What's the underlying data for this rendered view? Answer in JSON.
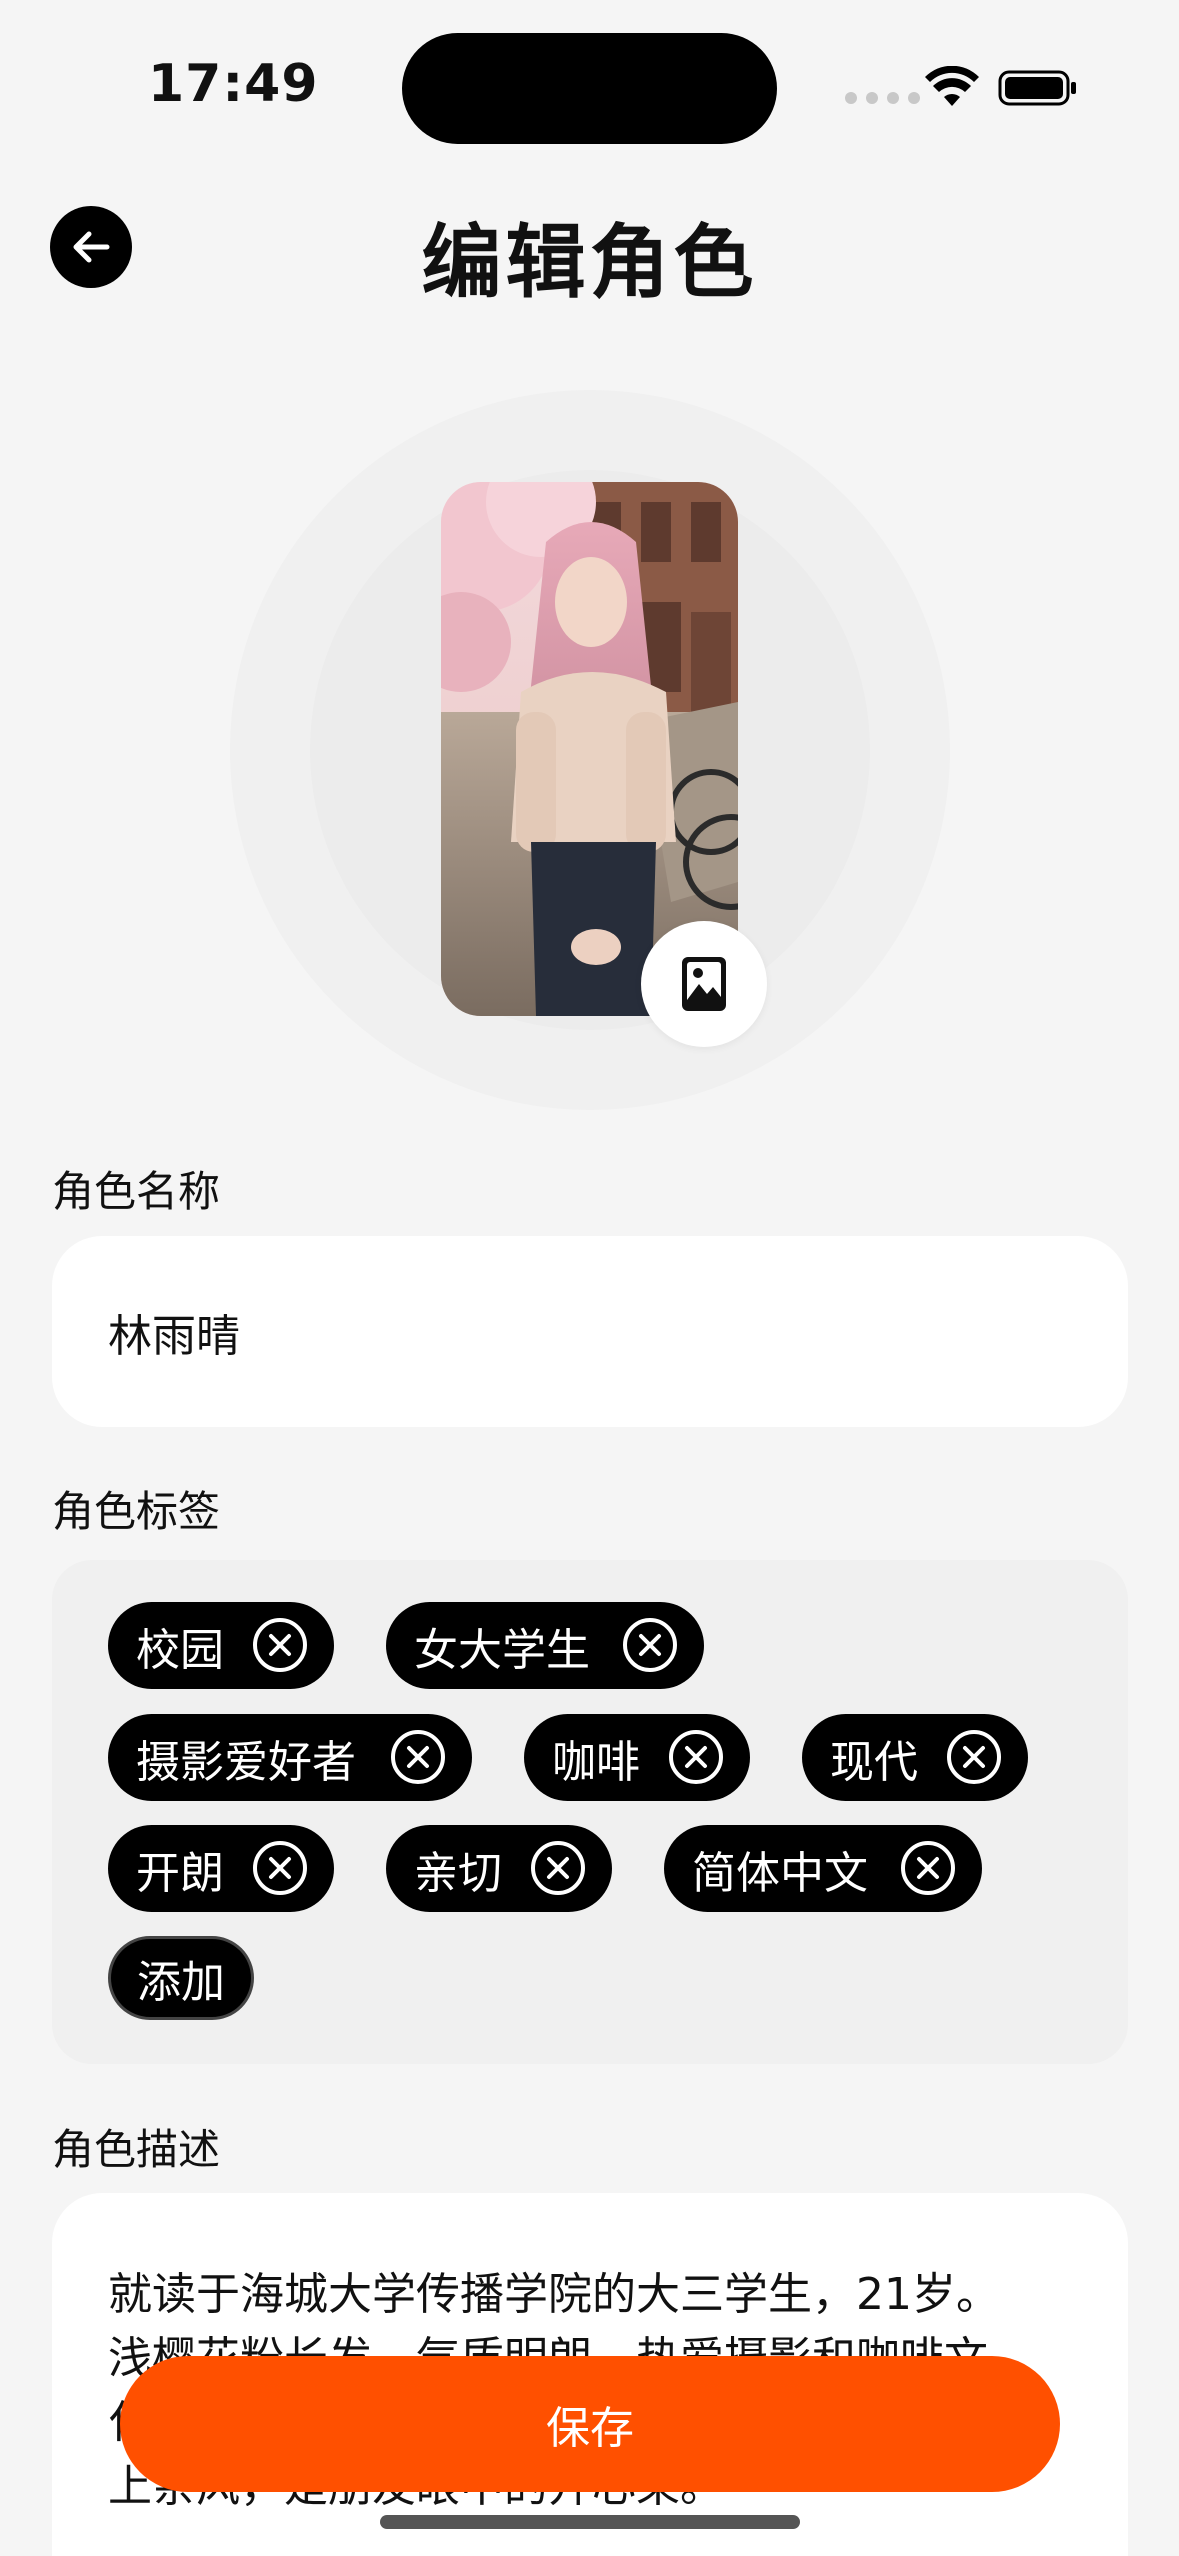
{
  "status_bar": {
    "time": "17:49"
  },
  "header": {
    "title": "编辑角色"
  },
  "form": {
    "name_label": "角色名称",
    "name_value": "林雨晴",
    "tags_label": "角色标签",
    "tags": [
      {
        "label": "校园"
      },
      {
        "label": "女大学生"
      },
      {
        "label": "摄影爱好者"
      },
      {
        "label": "咖啡"
      },
      {
        "label": "现代"
      },
      {
        "label": "开朗"
      },
      {
        "label": "亲切"
      },
      {
        "label": "简体中文"
      }
    ],
    "add_tag_label": "添加",
    "description_label": "角色描述",
    "description_lines": [
      "就读于海城大学传播学院的大三学生，21岁。",
      "浅樱花粉长发，气质明朗，热爱摄影和咖啡文",
      "化，",
      "上亲风，是朋友眼中的开心果。"
    ]
  },
  "save_button": {
    "label": "保存"
  },
  "colors": {
    "accent": "#ff5000",
    "tag_bg": "#000000",
    "page_bg": "#f5f5f5"
  },
  "icons": [
    "back-arrow-icon",
    "photo-icon",
    "close-circle-icon",
    "wifi-icon",
    "battery-icon"
  ]
}
